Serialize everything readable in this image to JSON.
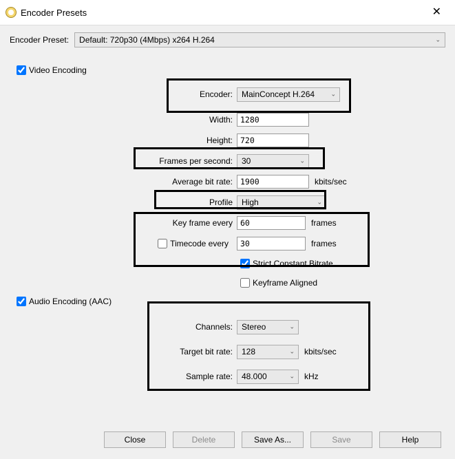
{
  "window": {
    "title": "Encoder Presets"
  },
  "presetRow": {
    "label": "Encoder Preset:",
    "value": "Default: 720p30 (4Mbps) x264 H.264"
  },
  "videoEncoding": {
    "checkboxLabel": "Video Encoding",
    "checked": true,
    "encoder": {
      "label": "Encoder:",
      "value": "MainConcept H.264"
    },
    "width": {
      "label": "Width:",
      "value": "1280"
    },
    "height": {
      "label": "Height:",
      "value": "720"
    },
    "fps": {
      "label": "Frames per second:",
      "value": "30"
    },
    "avgBitrate": {
      "label": "Average bit rate:",
      "value": "1900",
      "unit": "kbits/sec"
    },
    "profile": {
      "label": "Profile",
      "value": "High"
    },
    "keyframe": {
      "label": "Key frame every",
      "value": "60",
      "unit": "frames"
    },
    "timecode": {
      "label": "Timecode every",
      "value": "30",
      "unit": "frames",
      "checked": false
    },
    "strictCBR": {
      "label": "Strict Constant Bitrate",
      "checked": true
    },
    "keyframeAligned": {
      "label": "Keyframe Aligned",
      "checked": false
    }
  },
  "audioEncoding": {
    "checkboxLabel": "Audio Encoding (AAC)",
    "checked": true,
    "channels": {
      "label": "Channels:",
      "value": "Stereo"
    },
    "bitrate": {
      "label": "Target bit rate:",
      "value": "128",
      "unit": "kbits/sec"
    },
    "sampleRate": {
      "label": "Sample rate:",
      "value": "48.000",
      "unit": "kHz"
    }
  },
  "buttons": {
    "close": "Close",
    "delete": "Delete",
    "saveAs": "Save As...",
    "save": "Save",
    "help": "Help"
  }
}
